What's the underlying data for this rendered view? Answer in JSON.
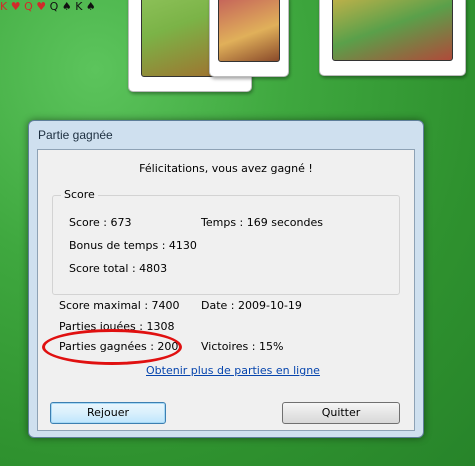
{
  "cards": [
    {
      "rank": "K",
      "suit": "♥",
      "color": "red"
    },
    {
      "rank": "Q",
      "suit": "♥",
      "color": "red"
    },
    {
      "rank": "Q",
      "suit": "♠",
      "color": "black"
    },
    {
      "rank": "K",
      "suit": "♠",
      "color": "black"
    }
  ],
  "dialog": {
    "title": "Partie gagnée",
    "message": "Félicitations, vous avez gagné !",
    "score_group": {
      "legend": "Score",
      "score": "Score : 673",
      "time": "Temps :  169 secondes",
      "time_bonus": "Bonus de temps : 4130",
      "total": "Score total : 4803"
    },
    "stats": {
      "max_score": "Score maximal : 7400",
      "date": "Date : 2009-10-19",
      "games_played": "Parties jouées : 1308",
      "games_won": "Parties gagnées : 200",
      "wins_pct": "Victoires : 15%"
    },
    "online_link": "Obtenir plus de parties en ligne",
    "replay_button": "Rejouer",
    "quit_button": "Quitter"
  },
  "colors": {
    "felt": "#3fa83f",
    "annotation": "#e01010",
    "link": "#0645ad"
  }
}
